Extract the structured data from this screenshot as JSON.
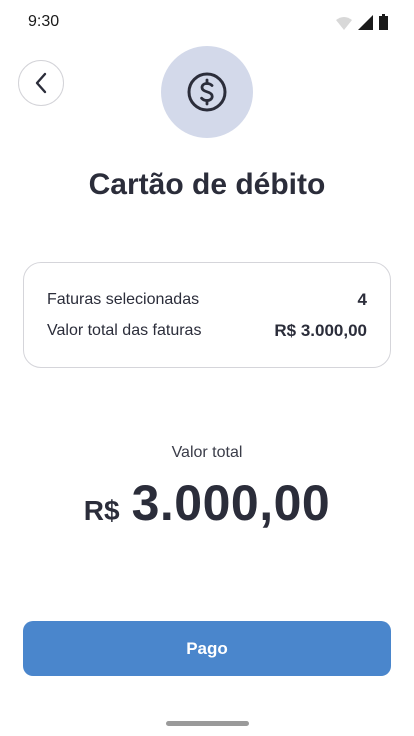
{
  "status_bar": {
    "time": "9:30",
    "icons": [
      "wifi-icon",
      "signal-icon",
      "battery-icon"
    ]
  },
  "header": {
    "back_icon": "chevron-left-icon",
    "hero_icon": "dollar-circle-icon",
    "title": "Cartão de débito"
  },
  "summary": {
    "rows": [
      {
        "label": "Faturas selecionadas",
        "value": "4"
      },
      {
        "label": "Valor total das faturas",
        "value": "R$ 3.000,00"
      }
    ]
  },
  "total": {
    "caption": "Valor total",
    "currency": "R$",
    "amount": "3.000,00"
  },
  "action": {
    "button_label": "Pago"
  },
  "colors": {
    "primary": "#4a86cc",
    "hero_bg": "#d3d9ea",
    "text": "#2b2d3a"
  }
}
